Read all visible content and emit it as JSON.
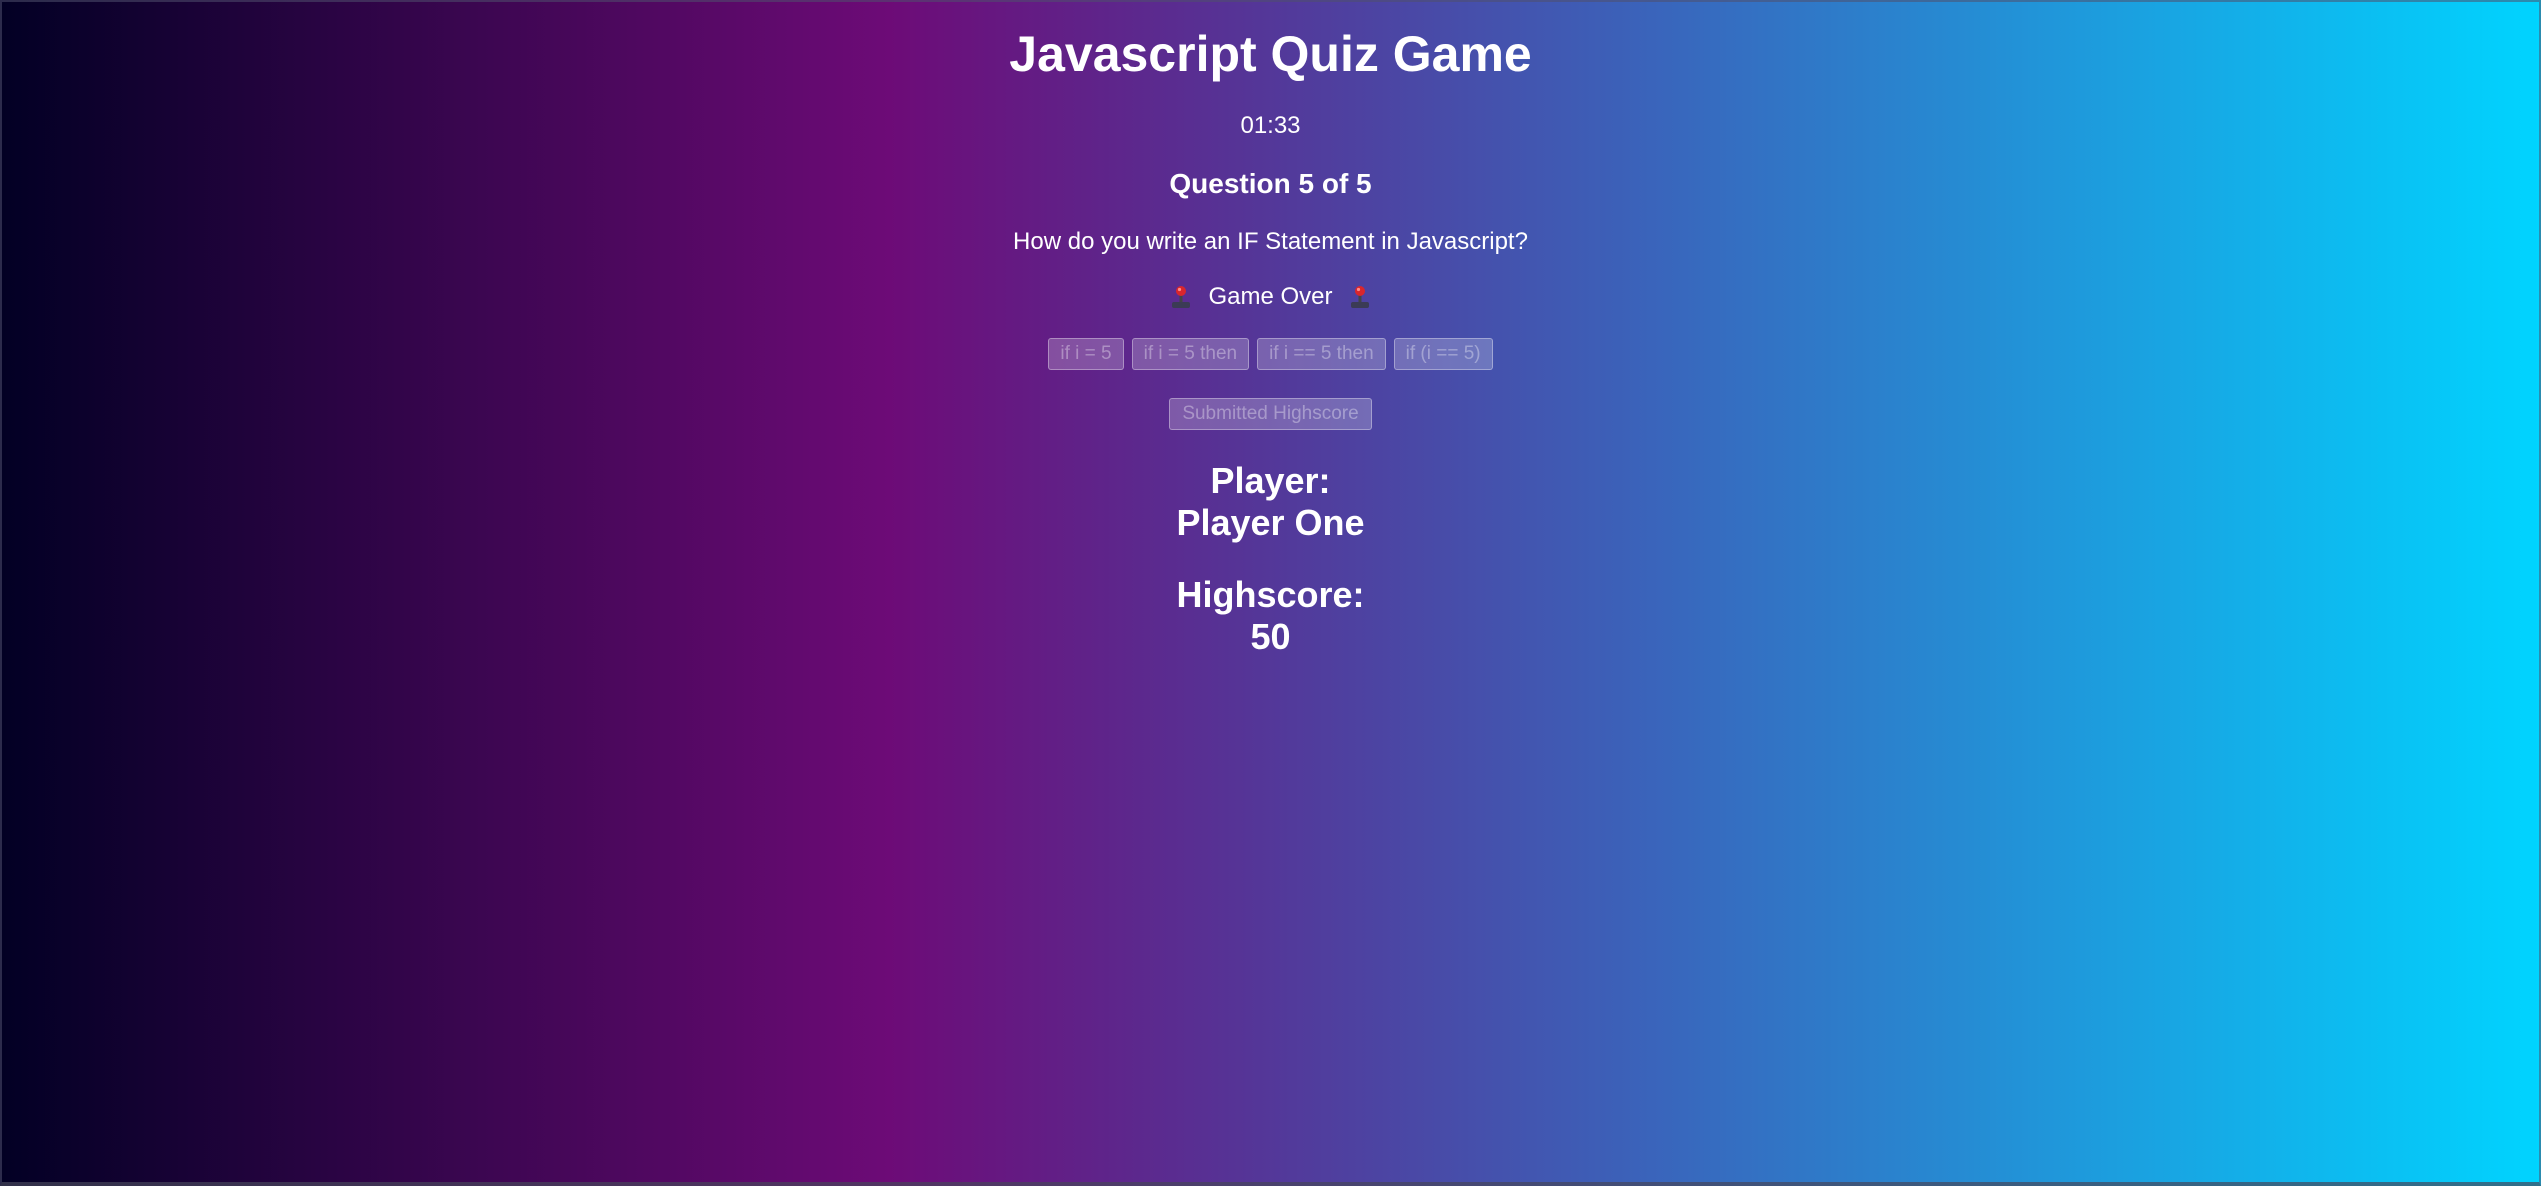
{
  "quiz": {
    "title": "Javascript Quiz Game",
    "timer": "01:33",
    "question_counter": "Question 5 of 5",
    "question_text": "How do you write an IF Statement in Javascript?",
    "status": "Game Over",
    "status_icon": "joystick-icon",
    "answers": [
      "if i = 5",
      "if i = 5 then",
      "if i == 5 then",
      "if (i == 5)"
    ],
    "submit_label": "Submitted Highscore"
  },
  "result": {
    "player_label": "Player:",
    "player_name": "Player One",
    "score_label": "Highscore:",
    "score_value": "50"
  },
  "colors": {
    "gradient": [
      "#020024",
      "#6d0b77",
      "#3a64bb",
      "#00d4ff"
    ],
    "text": "#ffffff"
  }
}
